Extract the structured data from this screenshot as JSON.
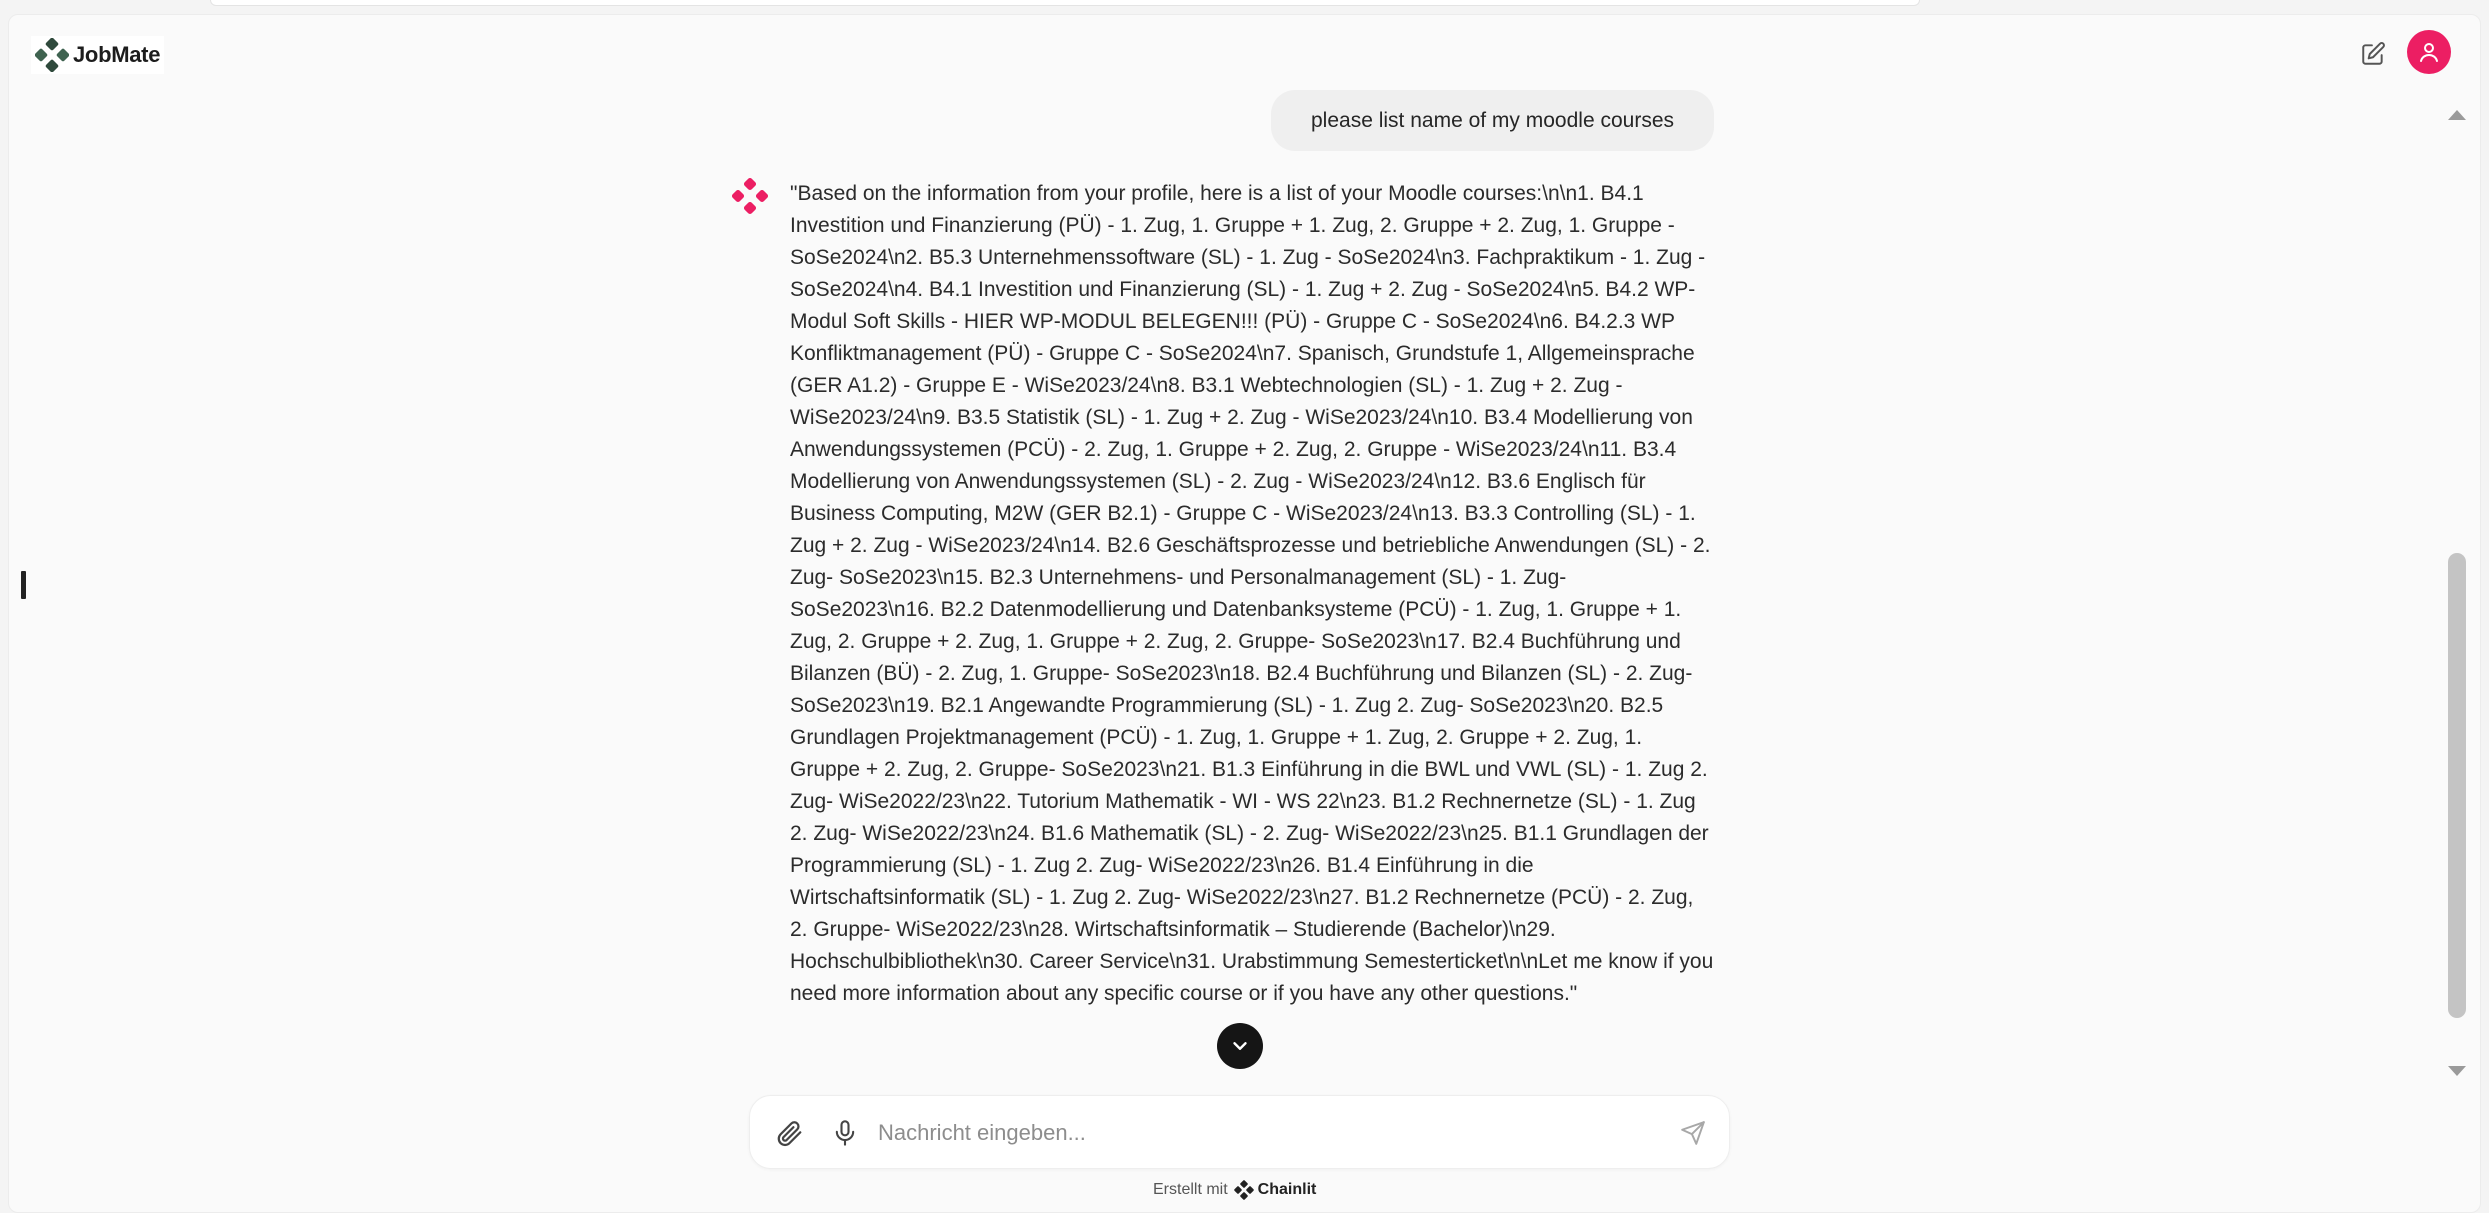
{
  "app": {
    "name": "JobMate"
  },
  "header": {
    "new_chat_icon": "edit-icon",
    "user_icon": "user-icon"
  },
  "conversation": {
    "user_message": "please list name of my moodle courses",
    "assistant_message": "\"Based on the information from your profile, here is a list of your Moodle courses:\\n\\n1. B4.1 Investition und Finanzierung (PÜ) - 1. Zug, 1. Gruppe + 1. Zug, 2. Gruppe + 2. Zug, 1. Gruppe - SoSe2024\\n2. B5.3 Unternehmenssoftware (SL) - 1. Zug - SoSe2024\\n3. Fachpraktikum - 1. Zug - SoSe2024\\n4. B4.1 Investition und Finanzierung (SL) - 1. Zug + 2. Zug - SoSe2024\\n5. B4.2 WP-Modul Soft Skills - HIER WP-MODUL BELEGEN!!! (PÜ) - Gruppe C - SoSe2024\\n6. B4.2.3 WP Konfliktmanagement (PÜ) - Gruppe C - SoSe2024\\n7. Spanisch, Grundstufe 1, Allgemeinsprache (GER A1.2) - Gruppe E - WiSe2023/24\\n8. B3.1 Webtechnologien (SL) - 1. Zug + 2. Zug - WiSe2023/24\\n9. B3.5 Statistik (SL) - 1. Zug + 2. Zug - WiSe2023/24\\n10. B3.4 Modellierung von Anwendungssystemen (PCÜ) - 2. Zug, 1. Gruppe + 2. Zug, 2. Gruppe - WiSe2023/24\\n11. B3.4 Modellierung von Anwendungssystemen (SL) - 2. Zug - WiSe2023/24\\n12. B3.6 Englisch für Business Computing, M2W (GER B2.1) - Gruppe C - WiSe2023/24\\n13. B3.3 Controlling (SL) - 1. Zug + 2. Zug - WiSe2023/24\\n14. B2.6 Geschäftsprozesse und betriebliche Anwendungen (SL) - 2. Zug- SoSe2023\\n15. B2.3 Unternehmens- und Personalmanagement (SL) - 1. Zug- SoSe2023\\n16. B2.2 Datenmodellierung und Datenbanksysteme (PCÜ) - 1. Zug, 1. Gruppe + 1. Zug, 2. Gruppe + 2. Zug, 1. Gruppe + 2. Zug, 2. Gruppe- SoSe2023\\n17. B2.4 Buchführung und Bilanzen (BÜ) - 2. Zug, 1. Gruppe- SoSe2023\\n18. B2.4 Buchführung und Bilanzen (SL) - 2. Zug- SoSe2023\\n19. B2.1 Angewandte Programmierung (SL) - 1. Zug 2. Zug- SoSe2023\\n20. B2.5 Grundlagen Projektmanagement (PCÜ) - 1. Zug, 1. Gruppe + 1. Zug, 2. Gruppe + 2. Zug, 1. Gruppe + 2. Zug, 2. Gruppe- SoSe2023\\n21. B1.3 Einführung in die BWL und VWL (SL) - 1. Zug 2. Zug- WiSe2022/23\\n22. Tutorium Mathematik - WI - WS 22\\n23. B1.2 Rechnernetze (SL) - 1. Zug 2. Zug- WiSe2022/23\\n24. B1.6 Mathematik (SL) - 2. Zug- WiSe2022/23\\n25. B1.1 Grundlagen der Programmierung (SL) - 1. Zug 2. Zug- WiSe2022/23\\n26. B1.4 Einführung in die Wirtschaftsinformatik (SL) - 1. Zug 2. Zug- WiSe2022/23\\n27. B1.2 Rechnernetze (PCÜ) - 2. Zug, 2. Gruppe- WiSe2022/23\\n28. Wirtschaftsinformatik – Studierende (Bachelor)\\n29. Hochschulbibliothek\\n30. Career Service\\n31. Urabstimmung Semesterticket\\n\\nLet me know if you need more information about any specific course or if you have any other questions.\""
  },
  "composer": {
    "placeholder": "Nachricht eingeben...",
    "value": ""
  },
  "footer": {
    "made_with": "Erstellt mit",
    "framework": "Chainlit"
  },
  "colors": {
    "accent": "#ec1e63",
    "logo_dark": "#2f4a3c",
    "background": "#fafafa",
    "user_bubble": "#efefef"
  }
}
